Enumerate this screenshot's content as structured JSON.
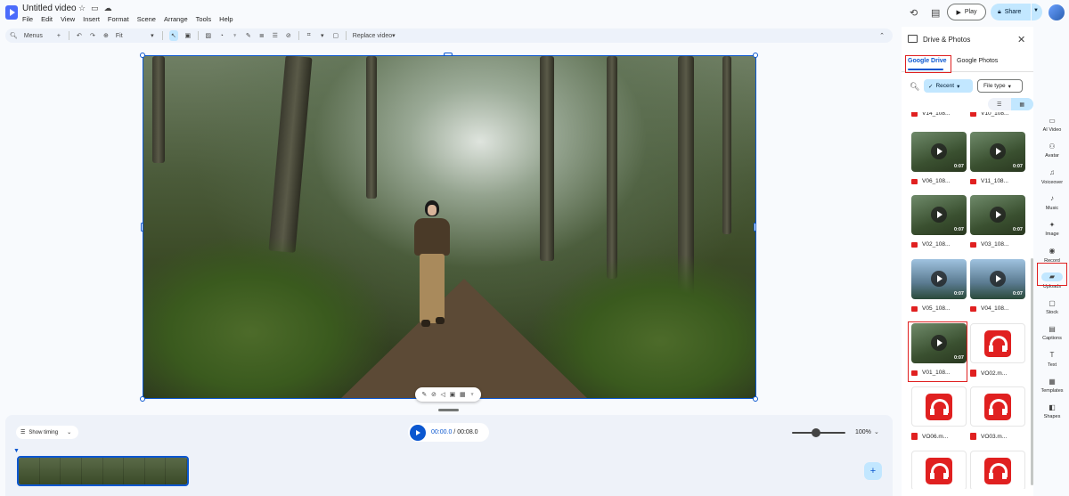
{
  "app": {
    "title": "Untitled video",
    "colors": {
      "accent": "#0b57d0",
      "accent_light": "#c2e7ff",
      "highlight": "#e02020"
    }
  },
  "menu": [
    "File",
    "Edit",
    "View",
    "Insert",
    "Format",
    "Scene",
    "Arrange",
    "Tools",
    "Help"
  ],
  "header": {
    "play_label": "Play",
    "share_label": "Share"
  },
  "toolbar": {
    "menus_label": "Menus",
    "zoom_label": "Fit",
    "replace_label": "Replace video"
  },
  "timeline": {
    "show_timing_label": "Show timing",
    "current_time": "00:00.0",
    "separator": " / ",
    "total_time": "00:08.0",
    "zoom_level": "100%"
  },
  "panel": {
    "title": "Drive & Photos",
    "tabs": [
      "Google Drive",
      "Google Photos"
    ],
    "recent_label": "Recent",
    "filetype_label": "File type",
    "items": [
      {
        "name": "V14_108...",
        "kind": "video",
        "duration": ""
      },
      {
        "name": "V10_108...",
        "kind": "video",
        "duration": ""
      },
      {
        "name": "V06_108...",
        "kind": "video",
        "duration": "0:07"
      },
      {
        "name": "V11_108...",
        "kind": "video",
        "duration": "0:07"
      },
      {
        "name": "V02_108...",
        "kind": "video",
        "duration": "0:07"
      },
      {
        "name": "V03_108...",
        "kind": "video",
        "duration": "0:07"
      },
      {
        "name": "V05_108...",
        "kind": "video",
        "duration": "0:07"
      },
      {
        "name": "V04_108...",
        "kind": "video",
        "duration": "0:07"
      },
      {
        "name": "V01_108...",
        "kind": "video",
        "duration": "0:07"
      },
      {
        "name": "VO02.m...",
        "kind": "audio",
        "duration": ""
      },
      {
        "name": "VO06.m...",
        "kind": "audio",
        "duration": ""
      },
      {
        "name": "VO03.m...",
        "kind": "audio",
        "duration": ""
      },
      {
        "name": "",
        "kind": "audio",
        "duration": ""
      },
      {
        "name": "",
        "kind": "audio",
        "duration": ""
      }
    ]
  },
  "rail": [
    {
      "label": "AI Video",
      "icon": "ai-video-icon"
    },
    {
      "label": "Avatar",
      "icon": "avatar-icon"
    },
    {
      "label": "Voiceover",
      "icon": "voiceover-icon"
    },
    {
      "label": "Music",
      "icon": "music-icon"
    },
    {
      "label": "Image",
      "icon": "image-icon"
    },
    {
      "label": "Record",
      "icon": "record-icon"
    },
    {
      "label": "Uploads",
      "icon": "uploads-icon"
    },
    {
      "label": "Stock",
      "icon": "stock-icon"
    },
    {
      "label": "Captions",
      "icon": "captions-icon"
    },
    {
      "label": "Text",
      "icon": "text-icon"
    },
    {
      "label": "Templates",
      "icon": "templates-icon"
    },
    {
      "label": "Shapes",
      "icon": "shapes-icon"
    }
  ]
}
